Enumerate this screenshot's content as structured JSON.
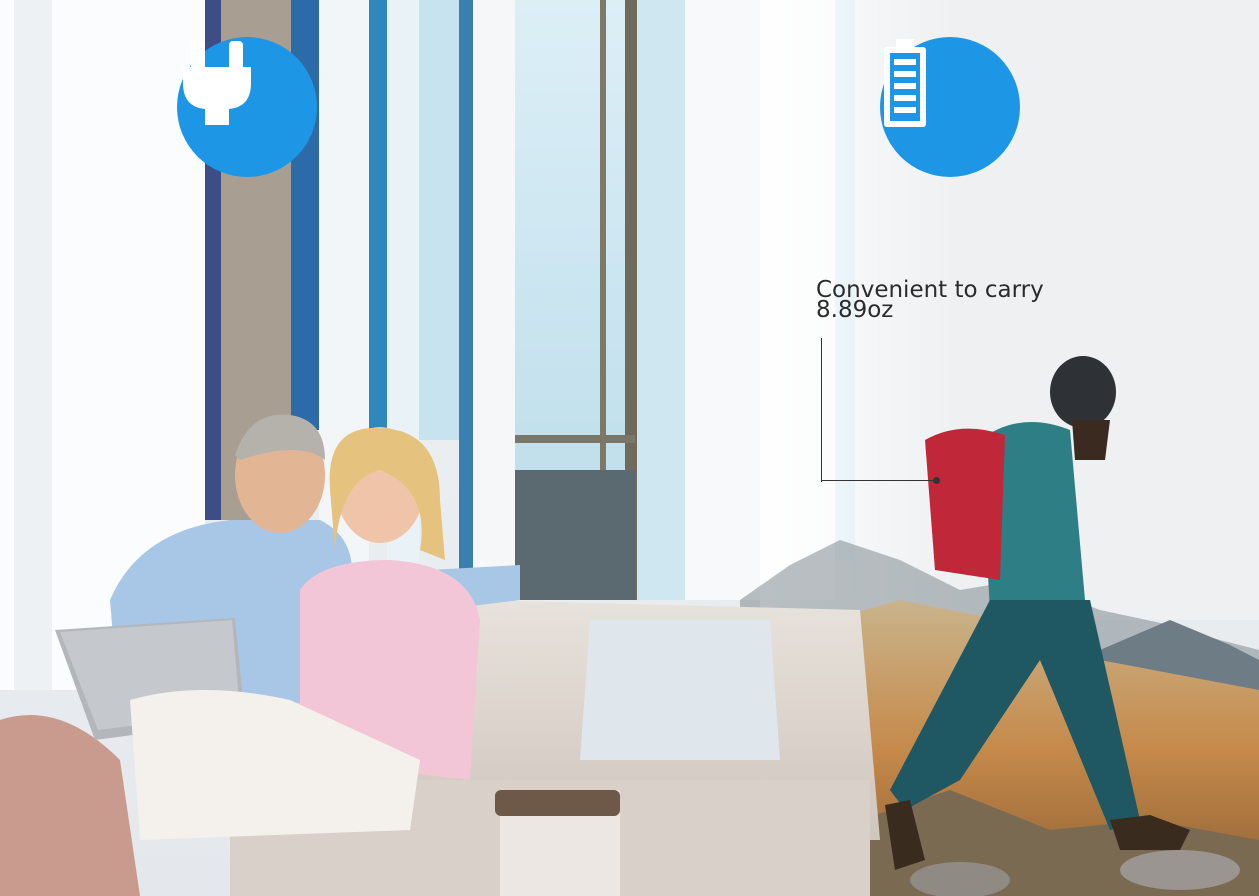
{
  "callout": {
    "line1": "Convenient to carry",
    "line2": "8.89oz"
  },
  "icons": {
    "left": "power-plug-icon",
    "right": "battery-icon"
  },
  "colors": {
    "icon_background": "#1e96e6",
    "icon_foreground": "#ffffff",
    "text": "#2b2b2b"
  }
}
